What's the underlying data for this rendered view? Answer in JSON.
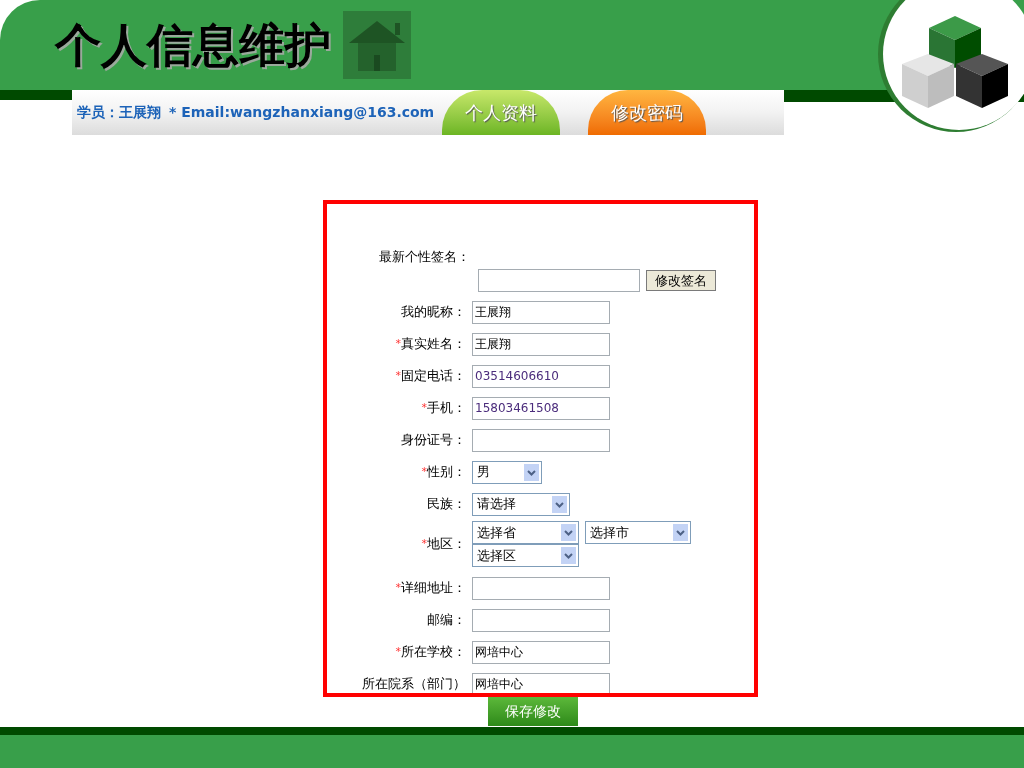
{
  "title": "个人信息维护",
  "header": {
    "student": "学员：王展翔",
    "email": "* Email:wangzhanxiang@163.com"
  },
  "tabs": [
    {
      "label": "个人资料",
      "selected": true
    },
    {
      "label": "修改密码",
      "selected": false
    }
  ],
  "form": {
    "signature_label": "最新个性签名：",
    "signature_button": "修改签名",
    "fields": [
      {
        "kind": "text",
        "label": "我的昵称：",
        "required": false,
        "value": "王展翔"
      },
      {
        "kind": "text",
        "label": "真实姓名：",
        "required": true,
        "value": "王展翔"
      },
      {
        "kind": "text",
        "label": "固定电话：",
        "required": true,
        "value": "03514606610"
      },
      {
        "kind": "text",
        "label": "手机：",
        "required": true,
        "value": "15803461508"
      },
      {
        "kind": "text",
        "label": "身份证号：",
        "required": false
      },
      {
        "kind": "select",
        "label": "性别：",
        "required": true,
        "value": "男"
      },
      {
        "kind": "select",
        "label": "民族：",
        "required": false,
        "value": "请选择"
      },
      {
        "kind": "region",
        "label": "地区：",
        "required": true,
        "province": "选择省",
        "city": "选择市",
        "district": "选择区"
      },
      {
        "kind": "text",
        "label": "详细地址：",
        "required": true
      },
      {
        "kind": "text",
        "label": "邮编：",
        "required": false
      },
      {
        "kind": "text",
        "label": "所在学校：",
        "required": true,
        "value": "网培中心"
      },
      {
        "kind": "text",
        "label": "所在院系（部门）",
        "required": false,
        "value": "网培中心"
      }
    ],
    "required_mark": "*"
  },
  "save_button": "保存修改"
}
